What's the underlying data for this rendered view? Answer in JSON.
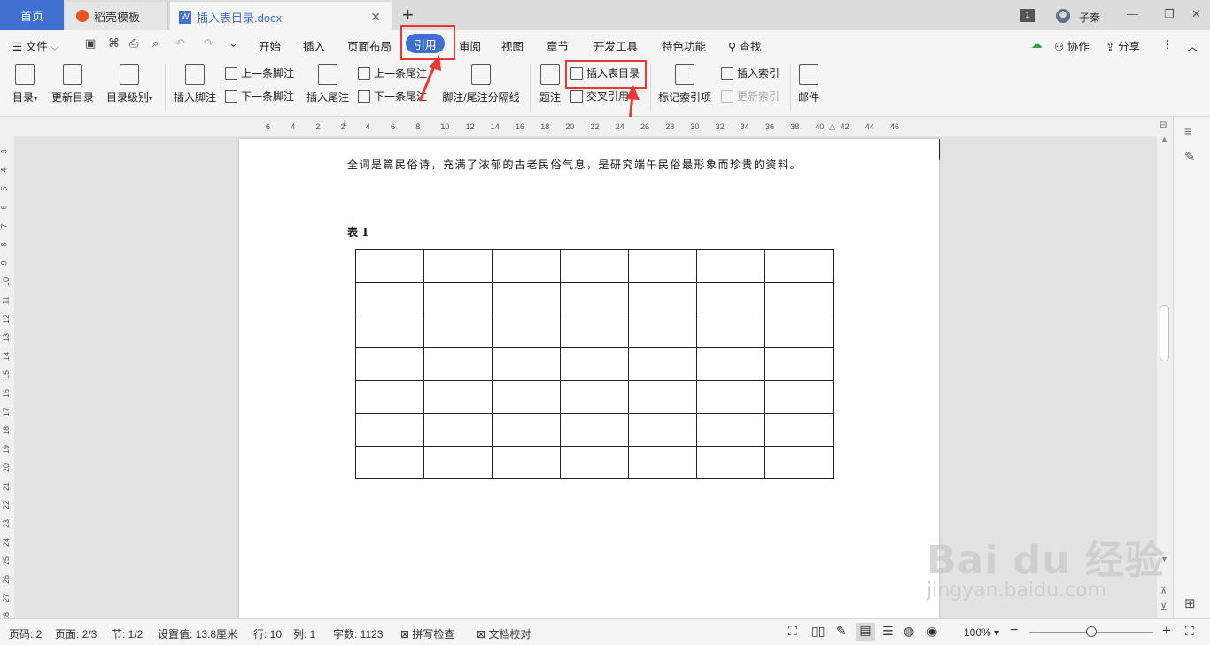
{
  "tabs": {
    "home": "首页",
    "template": "稻壳模板",
    "document": "插入表目录.docx",
    "add": "+"
  },
  "titlebar": {
    "badge": "1",
    "user": "子秦"
  },
  "menu": {
    "file": "文件",
    "items": [
      "开始",
      "插入",
      "页面布局",
      "引用",
      "审阅",
      "视图",
      "章节",
      "开发工具",
      "特色功能",
      "查找"
    ],
    "active": "引用",
    "collab": "协作",
    "share": "分享"
  },
  "ribbon": {
    "toc": "目录",
    "update_toc": "更新目录",
    "toc_level": "目录级别",
    "insert_footnote": "插入脚注",
    "prev_footnote": "上一条脚注",
    "next_footnote": "下一条脚注",
    "insert_endnote": "插入尾注",
    "prev_endnote": "上一条尾注",
    "next_endnote": "下一条尾注",
    "separator": "脚注/尾注分隔线",
    "caption": "题注",
    "insert_table_toc": "插入表目录",
    "cross_ref": "交叉引用",
    "mark_index": "标记索引项",
    "insert_index": "插入索引",
    "update_index": "更新索引",
    "mail": "邮件"
  },
  "ruler": {
    "h": [
      "6",
      "4",
      "2",
      "2",
      "4",
      "6",
      "8",
      "10",
      "12",
      "14",
      "16",
      "18",
      "20",
      "22",
      "24",
      "26",
      "28",
      "30",
      "32",
      "34",
      "36",
      "38",
      "40",
      "42",
      "44",
      "46"
    ],
    "v": [
      "3",
      "4",
      "5",
      "6",
      "7",
      "8",
      "9",
      "10",
      "11",
      "12",
      "13",
      "14",
      "15",
      "16",
      "17",
      "18",
      "19",
      "20",
      "21",
      "22",
      "23",
      "24",
      "25",
      "26",
      "27",
      "28"
    ]
  },
  "document": {
    "paragraph": "全词是篇民俗诗，充满了浓郁的古老民俗气息，是研究端午民俗最形象而珍贵的资料。",
    "caption": "表 1",
    "table_rows": 7,
    "table_cols": 7
  },
  "status": {
    "page_num": "页码: 2",
    "pages": "页面: 2/3",
    "section": "节: 1/2",
    "setting": "设置值: 13.8厘米",
    "row": "行: 10",
    "col": "列: 1",
    "words": "字数: 1123",
    "spell": "拼写检查",
    "proof": "文档校对",
    "zoom": "100%"
  },
  "watermark": {
    "main": "Bai du 经验",
    "sub": "jingyan.baidu.com"
  }
}
